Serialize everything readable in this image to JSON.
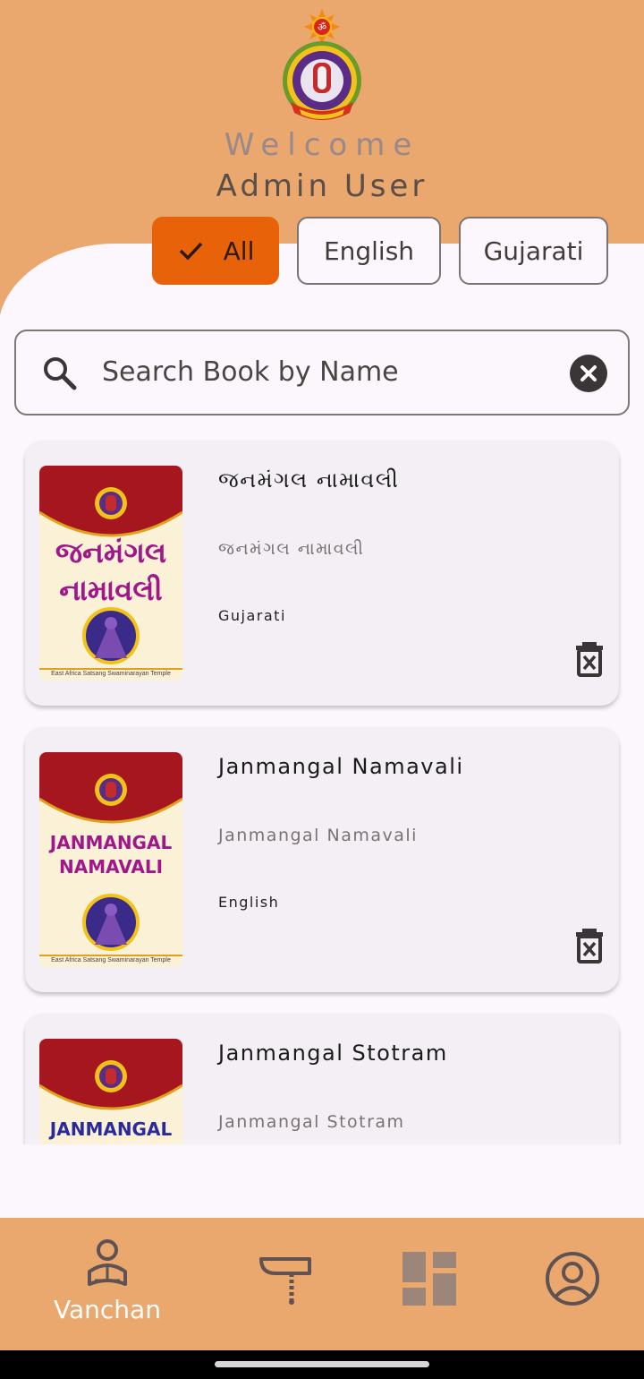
{
  "colors": {
    "header": "#eaa76e",
    "accent": "#e8620a",
    "background": "#fcf7fd",
    "card": "#f3eff5"
  },
  "header": {
    "welcome": "Welcome",
    "user_name": "Admin User",
    "logo_icon": "temple-emblem-logo"
  },
  "filters": {
    "all": "All",
    "english": "English",
    "gujarati": "Gujarati",
    "selected": "All"
  },
  "search": {
    "placeholder": "Search Book by Name",
    "icon": "search-icon",
    "clear_icon": "clear-circle-icon"
  },
  "books": [
    {
      "title": "જનમંગલ નામાવલી",
      "subtitle": "જનમંગલ નામાવલી",
      "language": "Gujarati",
      "cover_title": "જનમંગલ નામાવલી",
      "cover_footer": "East Africa Satsang Swaminarayan Temple"
    },
    {
      "title": "Janmangal Namavali",
      "subtitle": "Janmangal Namavali",
      "language": "English",
      "cover_title": "JANMANGAL NAMAVALI",
      "cover_footer": "East Africa Satsang Swaminarayan Temple"
    },
    {
      "title": "Janmangal Stotram",
      "subtitle": "Janmangal Stotram",
      "language": "",
      "cover_title": "JANMANGAL",
      "cover_footer": ""
    }
  ],
  "nav": {
    "vanchan": "Vanchan",
    "icons": [
      "reading-person-icon",
      "hammer-chain-icon",
      "dashboard-icon",
      "profile-icon"
    ],
    "active": "Vanchan"
  }
}
